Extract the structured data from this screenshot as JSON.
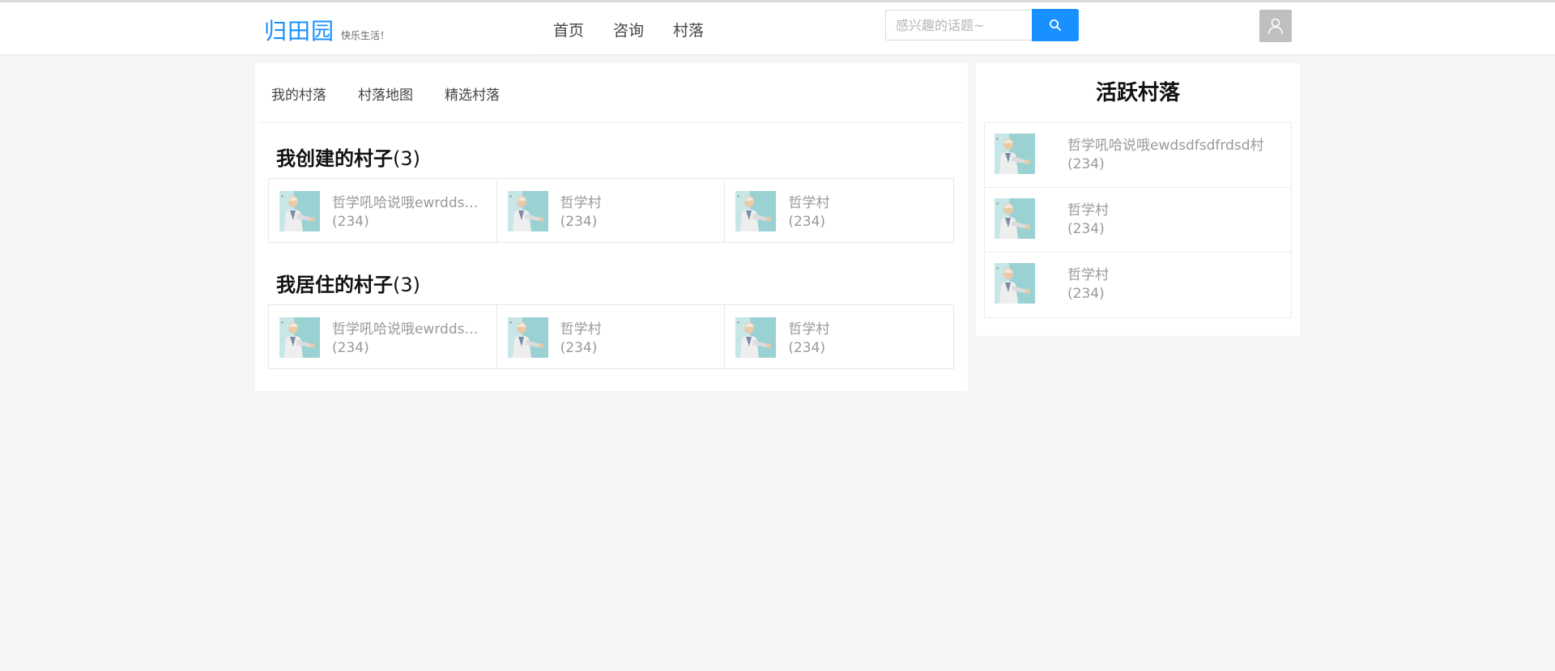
{
  "header": {
    "logo": "归田园",
    "slogan": "快乐生活！",
    "nav": [
      "首页",
      "咨询",
      "村落"
    ],
    "search_placeholder": "感兴趣的话题~"
  },
  "tabs": [
    "我的村落",
    "村落地图",
    "精选村落"
  ],
  "created": {
    "title": "我创建的村子",
    "count": "(3)",
    "villages": [
      {
        "name": "哲学吼哈说哦ewrddsdfsdfrdsd村",
        "members": "(234)"
      },
      {
        "name": "哲学村",
        "members": "(234)"
      },
      {
        "name": "哲学村",
        "members": "(234)"
      }
    ]
  },
  "lived": {
    "title": "我居住的村子",
    "count": "(3)",
    "villages": [
      {
        "name": "哲学吼哈说哦ewrddsdfsdfrdsd村",
        "members": "(234)"
      },
      {
        "name": "哲学村",
        "members": "(234)"
      },
      {
        "name": "哲学村",
        "members": "(234)"
      }
    ]
  },
  "active": {
    "title": "活跃村落",
    "villages": [
      {
        "name": "哲学吼哈说哦ewdsdfsdfrdsd村",
        "members": "(234)"
      },
      {
        "name": "哲学村",
        "members": "(234)"
      },
      {
        "name": "哲学村",
        "members": "(234)"
      }
    ]
  },
  "icons": {
    "search": "search-icon",
    "avatar": "user-icon",
    "thumb": "village-thumbnail"
  },
  "colors": {
    "accent": "#1890ff",
    "background": "#f5f5f5",
    "muted_text": "#999999"
  }
}
